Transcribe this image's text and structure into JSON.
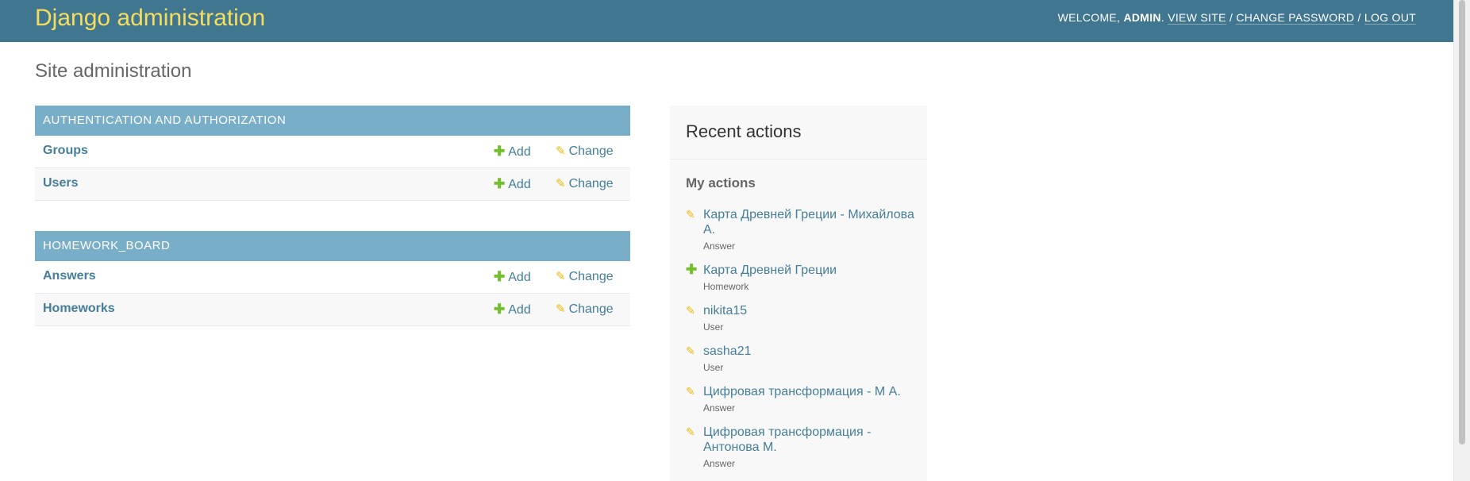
{
  "header": {
    "site_name": "Django administration",
    "welcome_label": "WELCOME,",
    "username": "ADMIN",
    "view_site": "VIEW SITE",
    "change_password": "CHANGE PASSWORD",
    "log_out": "LOG OUT",
    "separator": "/"
  },
  "page": {
    "title": "Site administration"
  },
  "apps": [
    {
      "caption": "AUTHENTICATION AND AUTHORIZATION",
      "models": [
        {
          "name": "Groups",
          "add": "Add",
          "change": "Change"
        },
        {
          "name": "Users",
          "add": "Add",
          "change": "Change"
        }
      ]
    },
    {
      "caption": "HOMEWORK_BOARD",
      "models": [
        {
          "name": "Answers",
          "add": "Add",
          "change": "Change"
        },
        {
          "name": "Homeworks",
          "add": "Add",
          "change": "Change"
        }
      ]
    }
  ],
  "recent_actions": {
    "title": "Recent actions",
    "my_actions_title": "My actions",
    "items": [
      {
        "icon": "pencil-icon",
        "text": "Карта Древней Греции - Михайлова А.",
        "type": "Answer"
      },
      {
        "icon": "plus-icon",
        "text": "Карта Древней Греции",
        "type": "Homework"
      },
      {
        "icon": "pencil-icon",
        "text": "nikita15",
        "type": "User"
      },
      {
        "icon": "pencil-icon",
        "text": "sasha21",
        "type": "User"
      },
      {
        "icon": "pencil-icon",
        "text": "Цифровая трансформация - М А.",
        "type": "Answer"
      },
      {
        "icon": "pencil-icon",
        "text": "Цифровая трансформация - Антонова М.",
        "type": "Answer"
      }
    ]
  },
  "colors": {
    "header_bg": "#417690",
    "brand": "#f5dd5d",
    "module_caption_bg": "#79aec8",
    "link": "#447e9b",
    "add_icon": "#70bf2b",
    "change_icon": "#efb80b"
  }
}
